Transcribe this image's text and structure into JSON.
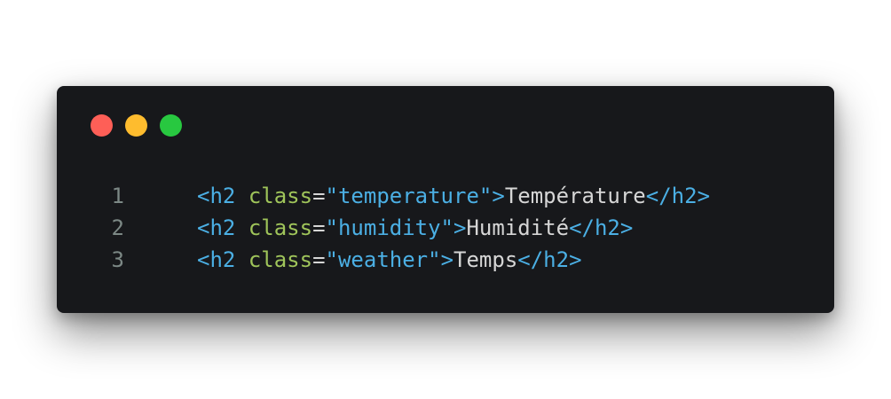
{
  "colors": {
    "background": "#17181b",
    "tag": "#4bafe4",
    "attribute": "#9fc45a",
    "text": "#d6d6d6",
    "line_number": "#7c8885",
    "close_dot": "#fe5f57",
    "minimize_dot": "#febc2e",
    "maximize_dot": "#28c840"
  },
  "code": {
    "lines": [
      {
        "number": "1",
        "open_tag": "<h2",
        "attr": "class",
        "eq": "=",
        "value": "\"temperature\"",
        "close_bracket": ">",
        "content": "Température",
        "end_tag": "</h2>"
      },
      {
        "number": "2",
        "open_tag": "<h2",
        "attr": "class",
        "eq": "=",
        "value": "\"humidity\"",
        "close_bracket": ">",
        "content": "Humidité",
        "end_tag": "</h2>"
      },
      {
        "number": "3",
        "open_tag": "<h2",
        "attr": "class",
        "eq": "=",
        "value": "\"weather\"",
        "close_bracket": ">",
        "content": "Temps",
        "end_tag": "</h2>"
      }
    ]
  }
}
